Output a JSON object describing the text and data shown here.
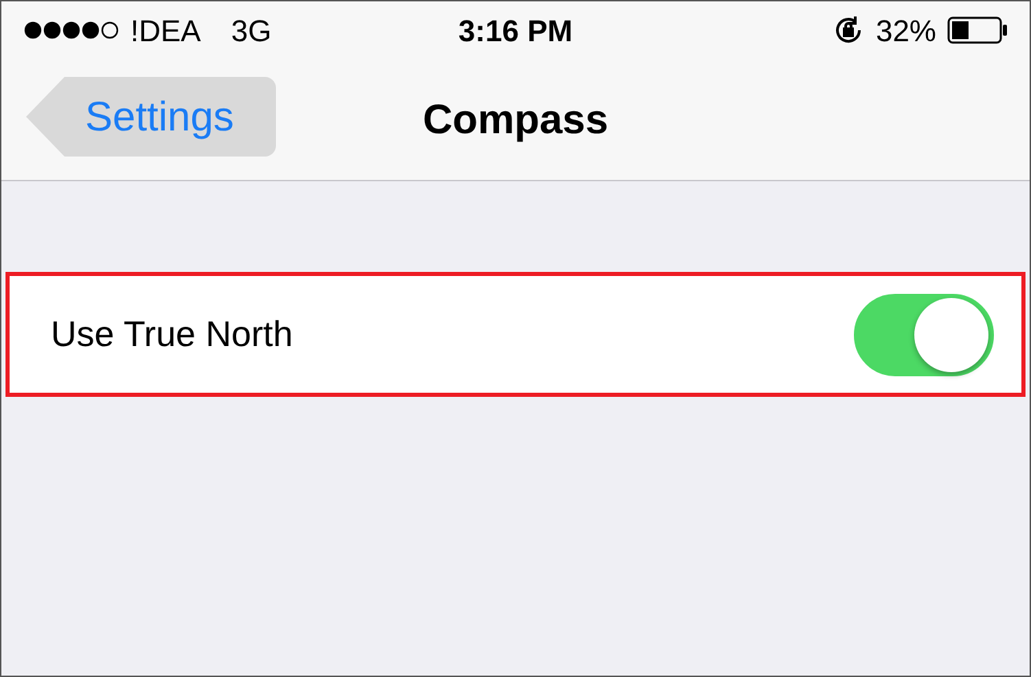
{
  "status_bar": {
    "carrier": "!DEA",
    "network": "3G",
    "time": "3:16 PM",
    "battery": "32%"
  },
  "nav": {
    "back": "Settings",
    "title": "Compass"
  },
  "settings": [
    {
      "label": "Use True North",
      "on": true,
      "highlighted": true
    }
  ]
}
